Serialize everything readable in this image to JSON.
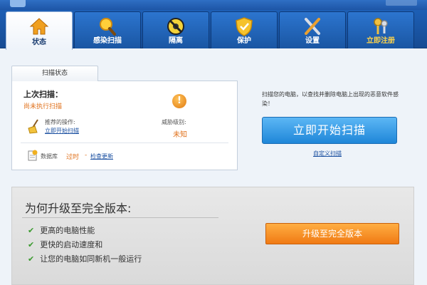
{
  "nav": {
    "tabs": [
      {
        "label": "状态",
        "icon": "house-icon"
      },
      {
        "label": "感染扫描",
        "icon": "magnifier-icon"
      },
      {
        "label": "隔离",
        "icon": "no-virus-icon"
      },
      {
        "label": "保护",
        "icon": "shield-icon"
      },
      {
        "label": "设置",
        "icon": "tools-icon"
      },
      {
        "label": "立即注册",
        "icon": "keys-icon"
      }
    ]
  },
  "status_panel": {
    "tab_label": "扫描状态",
    "last_scan_title": "上次扫描：",
    "last_scan_status": "尚未执行扫描",
    "recommended_label": "推荐的操作:",
    "recommended_link": "立即开始扫描",
    "threat_label": "威胁级别:",
    "threat_value": "未知",
    "database_label": "数据库",
    "database_status": "过时",
    "database_separator": "-",
    "update_link": "检查更新"
  },
  "scan": {
    "description": "扫描您的电脑，以查找并删除电脑上出现的恶意软件感染！",
    "button_label": "立即开始扫描",
    "custom_link": "自定义扫描"
  },
  "upgrade": {
    "title": "为何升级至完全版本:",
    "benefits": [
      "更高的电脑性能",
      "更快的启动速度和",
      "让您的电脑如同新机一般运行"
    ],
    "button_label": "升级至完全版本"
  },
  "colors": {
    "nav_blue": "#1d5fb5",
    "warning_orange": "#e0701a",
    "scan_button_blue": "#2b8ee0",
    "upgrade_orange": "#f5891f",
    "check_green": "#3a9a2e"
  }
}
